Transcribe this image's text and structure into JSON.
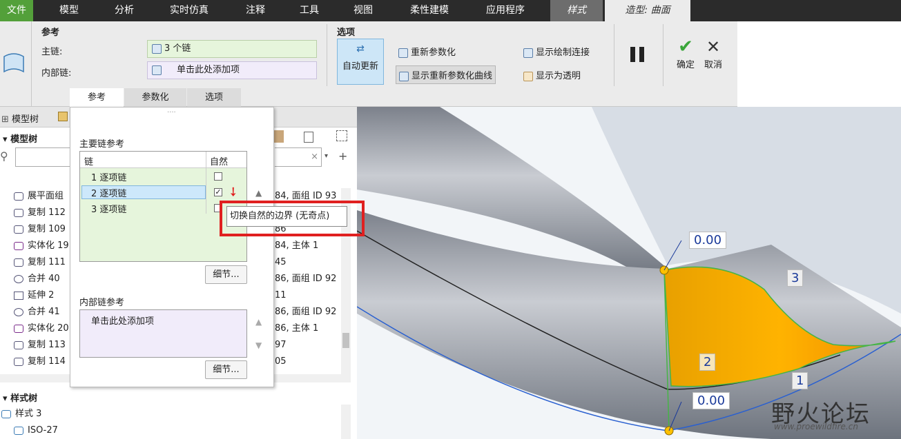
{
  "menubar": {
    "items": [
      "文件",
      "模型",
      "分析",
      "实时仿真",
      "注释",
      "工具",
      "视图",
      "柔性建模",
      "应用程序",
      "样式",
      "造型: 曲面"
    ]
  },
  "ribbon": {
    "ref_group_title": "参考",
    "main_chain_label": "主链:",
    "main_chain_value": "3 个链",
    "inner_chain_label": "内部链:",
    "inner_chain_value": "单击此处添加项",
    "options_group_title": "选项",
    "auto_update": "自动更新",
    "reparam": "重新参数化",
    "show_reparam_curves": "显示重新参数化曲线",
    "show_draw_connect": "显示绘制连接",
    "show_transparent": "显示为透明",
    "ok": "确定",
    "cancel": "取消",
    "tabs": [
      "参考",
      "参数化",
      "选项"
    ]
  },
  "left": {
    "model_tree_tab": "模型树",
    "model_tree_header": "模型树",
    "items": [
      "展平面组",
      "复制 112",
      "复制 109",
      "实体化 19",
      "复制 111",
      "合并 40",
      "延伸 2",
      "合并 41",
      "实体化 20",
      "复制 113",
      "复制 114"
    ],
    "right_texts": [
      "84, 面组 ID 93",
      "",
      "86",
      "84, 主体 1",
      "45",
      "86, 面组 ID 92",
      "11",
      "86, 面组 ID 92",
      "86, 主体 1",
      "97",
      "05"
    ],
    "style_tree_header": "样式树",
    "style_items": [
      "样式 3",
      "ISO-27"
    ]
  },
  "panel": {
    "main_chain_ref": "主要链参考",
    "col_chain": "链",
    "col_natural": "自然",
    "rows": [
      "1 逐项链",
      "2 逐项链",
      "3 逐项链"
    ],
    "detail": "细节...",
    "inner_chain_ref": "内部链参考",
    "inner_placeholder": "单击此处添加项",
    "tooltip": "切换自然的边界 (无奇点)"
  },
  "viewport": {
    "label_top": "0.00",
    "label_bottom": "0.00",
    "label_1": "1",
    "label_2": "2",
    "label_3": "3",
    "watermark_cn": "野火论坛",
    "watermark_url": "www.proewildfire.cn"
  }
}
